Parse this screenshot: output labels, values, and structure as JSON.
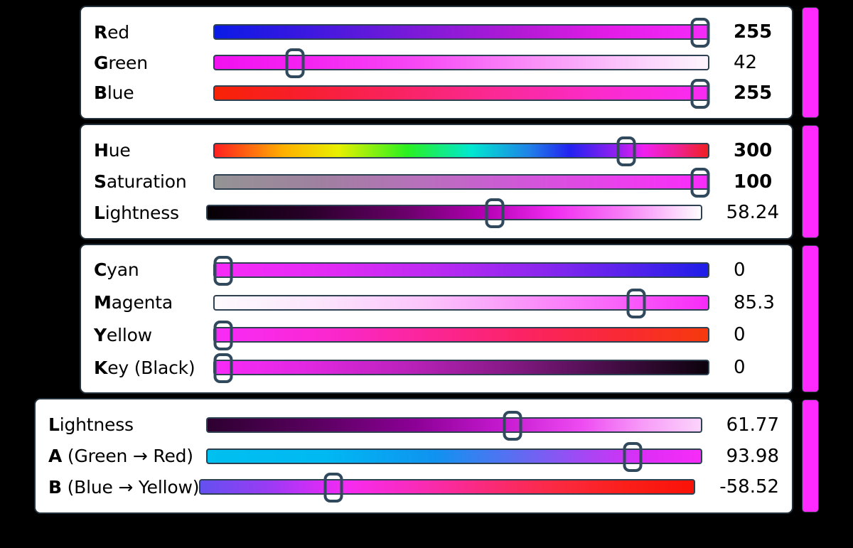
{
  "app": {
    "title": "Color Picker Sliders",
    "background_color": "#000000",
    "panel_background": "#ffffff",
    "panel_border_color": "#22313c",
    "thumb_border_color": "#31495c",
    "track_border_color": "#2e4152",
    "preview_color": "#ff2aff"
  },
  "panels": [
    {
      "name": "rgb",
      "preview_label": "color-preview-rgb",
      "preview_color": "#ff2aff",
      "rows": [
        {
          "name": "red",
          "label_bold": "R",
          "label_rest": "ed",
          "value": "255",
          "value_bold": true,
          "percent": 100,
          "gradient": "linear-gradient(90deg, #0a1ae6 0%, #3a18e0 18%, #7a1ad8 40%, #b41ad6 62%, #e31ce8 80%, #f62bf9 100%)"
        },
        {
          "name": "green",
          "label_bold": "G",
          "label_rest": "reen",
          "value": "42",
          "value_bold": false,
          "percent": 16.5,
          "gradient": "linear-gradient(90deg, #f211f0 0%, #f422f2 18%, #f74bf5 42%, #f98df8 64%, #fbc3fb 82%, #fdf6fd 100%)"
        },
        {
          "name": "blue",
          "label_bold": "B",
          "label_rest": "lue",
          "value": "255",
          "value_bold": true,
          "percent": 100,
          "gradient": "linear-gradient(90deg, #f72205 0%, #f81e2c 17%, #f92363 38%, #fa2a9e 60%, #fb2bd0 80%, #f92bf4 100%)"
        }
      ]
    },
    {
      "name": "hsl",
      "preview_label": "color-preview-hsl",
      "preview_color": "#ff2aff",
      "rows": [
        {
          "name": "hue",
          "label_bold": "H",
          "label_rest": "ue",
          "value": "300",
          "value_bold": true,
          "percent": 83.3,
          "gradient": "linear-gradient(90deg, #ff2020 0%, #ffb000 14%, #e8f000 25%, #2af020 39%, #00e8d0 52%, #1f7fe8 64%, #2222f0 72%, #9a20f0 82%, #f020f0 87%, #f02090 94%, #f02020 100%)"
        },
        {
          "name": "saturation",
          "label_bold": "S",
          "label_rest": "aturation",
          "value": "100",
          "value_bold": true,
          "percent": 100,
          "gradient": "linear-gradient(90deg, #949494 0%, #a080a0 22%, #b870bc 42%, #d058d8 62%, #ea40ec 82%, #fb2bfb 100%)"
        },
        {
          "name": "lightness",
          "label_bold": "L",
          "label_rest": "ightness",
          "value": "58.24",
          "value_bold": false,
          "percent": 58.24,
          "gradient": "linear-gradient(90deg, #050005 0%, #280028 20%, #6a006a 40%, #b300b3 56%, #f02bf0 70%, #f77cf7 84%, #fefdfe 100%)"
        }
      ]
    },
    {
      "name": "cmyk",
      "preview_label": "color-preview-cmyk",
      "preview_color": "#ff2aff",
      "rows": [
        {
          "name": "cyan",
          "label_bold": "C",
          "label_rest": "yan",
          "value": "0",
          "value_bold": false,
          "percent": 0,
          "gradient": "linear-gradient(90deg, #f82bf8 0%, #e32bf4 22%, #bd2bf2 44%, #8c27ee 66%, #4f22ec 86%, #1d1ee8 100%)"
        },
        {
          "name": "magenta",
          "label_bold": "M",
          "label_rest": "agenta",
          "value": "85.3",
          "value_bold": false,
          "percent": 85.3,
          "gradient": "linear-gradient(90deg, #fdfafd 0%, #fce6fc 20%, #fbc6fb 42%, #fa96fa 62%, #f962f9 82%, #f82bf8 100%)"
        },
        {
          "name": "yellow",
          "label_bold": "Y",
          "label_rest": "ellow",
          "value": "0",
          "value_bold": false,
          "percent": 0,
          "gradient": "linear-gradient(90deg, #f82bf8 0%, #fa28d6 20%, #fb2596 44%, #fb2360 64%, #f92a30 84%, #f63a0c 100%)"
        },
        {
          "name": "key-black",
          "label_bold": "K",
          "label_rest": "ey (Black)",
          "value": "0",
          "value_bold": false,
          "percent": 0,
          "gradient": "linear-gradient(90deg, #f82bf8 0%, #e228e2 18%, #bd22bd 38%, #8a1a8a 58%, #4d0f4d 78%, #0c020c 100%)"
        }
      ]
    },
    {
      "name": "lab",
      "preview_label": "color-preview-lab",
      "preview_color": "#ff2aff",
      "rows": [
        {
          "name": "lab-lightness",
          "label_bold": "L",
          "label_rest": "ightness",
          "value": "61.77",
          "value_bold": false,
          "percent": 61.77,
          "gradient": "linear-gradient(90deg, #2d0030 0%, #5a0060 22%, #8c0096 42%, #c61ad0 60%, #ee4cf2 76%, #f79af8 88%, #fbd4fb 100%)"
        },
        {
          "name": "lab-a-green-red",
          "label_bold": "A",
          "label_rest": " (Green → Red)",
          "value": "93.98",
          "value_bold": false,
          "percent": 86,
          "gradient": "linear-gradient(90deg, #00c0f0 0%, #00b8f2 24%, #0f93f0 46%, #5a6ef2 62%, #a348f4 76%, #dc2ef6 88%, #f82bf8 100%)"
        },
        {
          "name": "lab-b-blue-yellow",
          "label_bold": "B",
          "label_rest": " (Blue → Yellow)",
          "value": "-58.52",
          "value_bold": false,
          "percent": 27,
          "gradient": "linear-gradient(90deg, #6450f0 0%, #9b3bf4 14%, #d62cf7 24%, #f72bf0 30%, #f92bb8 44%, #fa2a7a 58%, #fb2a42 72%, #fb1f1a 86%, #f91208 100%)"
        }
      ]
    }
  ]
}
